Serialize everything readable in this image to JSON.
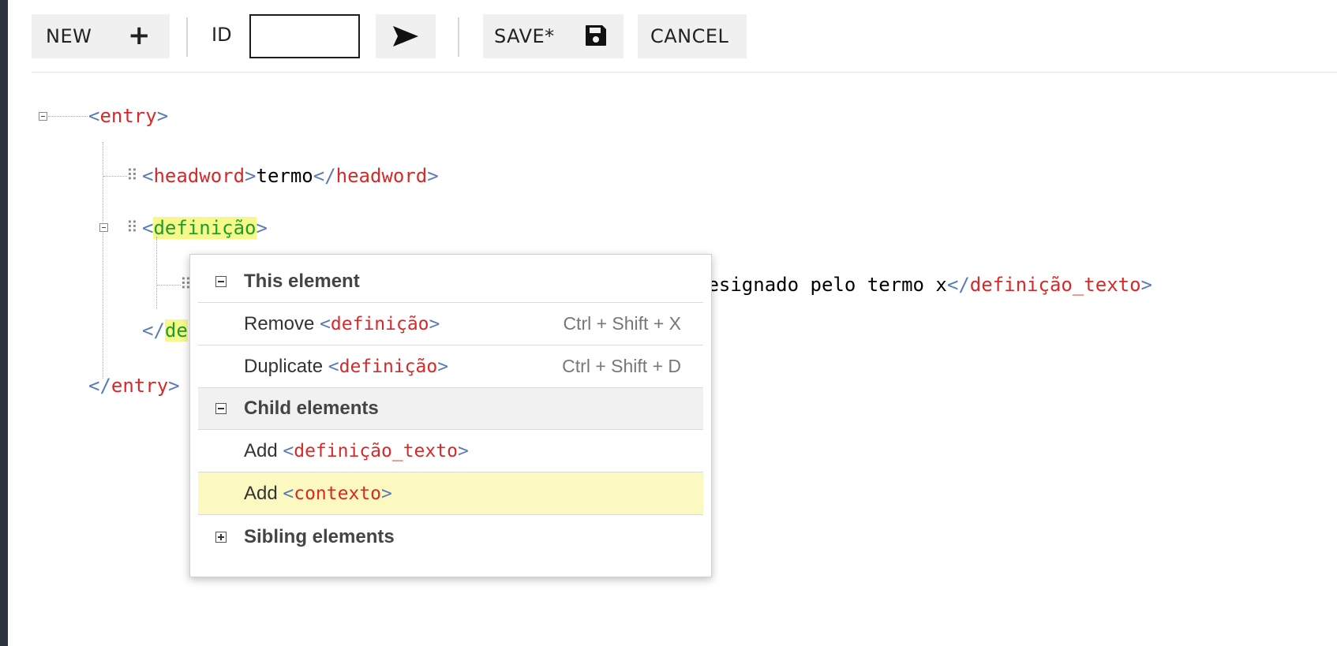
{
  "toolbar": {
    "new_label": "NEW",
    "new_icon": "+",
    "id_label": "ID",
    "id_value": "",
    "save_label": "SAVE*",
    "cancel_label": "CANCEL"
  },
  "tree": {
    "entry_open": {
      "lt": "<",
      "name": "entry",
      "gt": ">"
    },
    "headword": {
      "lt": "<",
      "name": "headword",
      "gt": ">",
      "text": "termo",
      "close_lt": "</",
      "close_name": "headword",
      "close_gt": ">"
    },
    "definicao_open": {
      "lt": "<",
      "name": "definição",
      "gt": ">"
    },
    "definicao_texto_line": {
      "text": "designado pelo termo x",
      "close_lt": "</",
      "close_name": "definição_texto",
      "close_gt": ">"
    },
    "definicao_close": {
      "lt": "</",
      "name": "de"
    },
    "entry_close": {
      "lt": "</",
      "name": "entry",
      "gt": ">"
    }
  },
  "context_menu": {
    "this_element": "This element",
    "remove_label": "Remove",
    "remove_tag": "<definição>",
    "remove_shortcut": "Ctrl + Shift + X",
    "duplicate_label": "Duplicate",
    "duplicate_tag": "<definição>",
    "duplicate_shortcut": "Ctrl + Shift + D",
    "child_elements": "Child elements",
    "add_label": "Add",
    "add_def_texto_tag": "<definição_texto>",
    "add_contexto_tag": "<contexto>",
    "sibling_elements": "Sibling elements"
  },
  "colors": {
    "tag_name": "#d62a2a",
    "bracket": "#5a7bb5",
    "highlight_bg": "#f6f98a",
    "highlight_tag": "#219c2a",
    "menu_active": "#fbf9c0"
  }
}
